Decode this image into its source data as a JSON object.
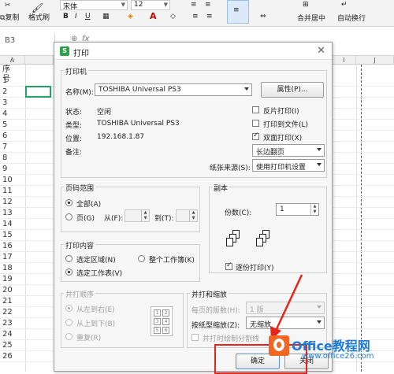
{
  "ribbon": {
    "copy_label": "复制",
    "format_painter_label": "格式刷",
    "font_name": "宋体",
    "font_size": "12",
    "merge_center_label": "合并居中",
    "wrap_text_label": "自动换行"
  },
  "formula_bar": {
    "cell_ref": "B3",
    "fx_label": "fx"
  },
  "sheet": {
    "columns": [
      "A",
      "I",
      "J"
    ],
    "a1_text": "序号",
    "rows": [
      "1",
      "2",
      "3",
      "4",
      "5",
      "6",
      "7",
      "8",
      "9",
      "10",
      "11",
      "12",
      "13",
      "14",
      "15",
      "16",
      "17",
      "18",
      "19",
      "20",
      "21",
      "22",
      "23",
      "24",
      "25",
      "26"
    ]
  },
  "dialog": {
    "title": "打印",
    "printer": {
      "group_title": "打印机",
      "name_label": "名称(M):",
      "name_value": "TOSHIBA Universal PS3",
      "properties_button": "属性(P)...",
      "status_label": "状态:",
      "status_value": "空闲",
      "type_label": "类型:",
      "type_value": "TOSHIBA Universal PS3",
      "location_label": "位置:",
      "location_value": "192.168.1.87",
      "note_label": "备注:",
      "reverse_print": "反片打印(I)",
      "print_to_file": "打印到文件(L)",
      "duplex": "双面打印(X)",
      "duplex_mode": "长边翻页",
      "paper_source_label": "纸张来源(S):",
      "paper_source_value": "使用打印机设置"
    },
    "page_range": {
      "group_title": "页码范围",
      "all": "全部(A)",
      "pages": "页(G)",
      "from": "从(F):",
      "to": "到(T):"
    },
    "copies": {
      "group_title": "副本",
      "count_label": "份数(C):",
      "count_value": "1",
      "collate": "逐份打印(Y)"
    },
    "print_what": {
      "group_title": "打印内容",
      "selection": "选定区域(N)",
      "workbook": "整个工作簿(K)",
      "sheet": "选定工作表(V)"
    },
    "order": {
      "group_title": "并打顺序",
      "left_to_right": "从左到右(E)",
      "top_to_bottom": "从上到下(B)",
      "repeat": "重复(R)"
    },
    "zoom": {
      "group_title": "并打和缩放",
      "pages_per_sheet_label": "每页的版数(H):",
      "pages_per_sheet_value": "1 版",
      "scale_label": "按纸型缩放(Z):",
      "scale_value": "无缩放",
      "draw_lines": "并打时绘制分割线"
    },
    "ok_button": "确定",
    "cancel_button": "关闭"
  },
  "watermark": {
    "title": "Office教程网",
    "url": "www.office26.com"
  },
  "colors": {
    "annotation_red": "#e8231b",
    "excel_green": "#21a366",
    "watermark_blue": "#1f7bd6"
  }
}
